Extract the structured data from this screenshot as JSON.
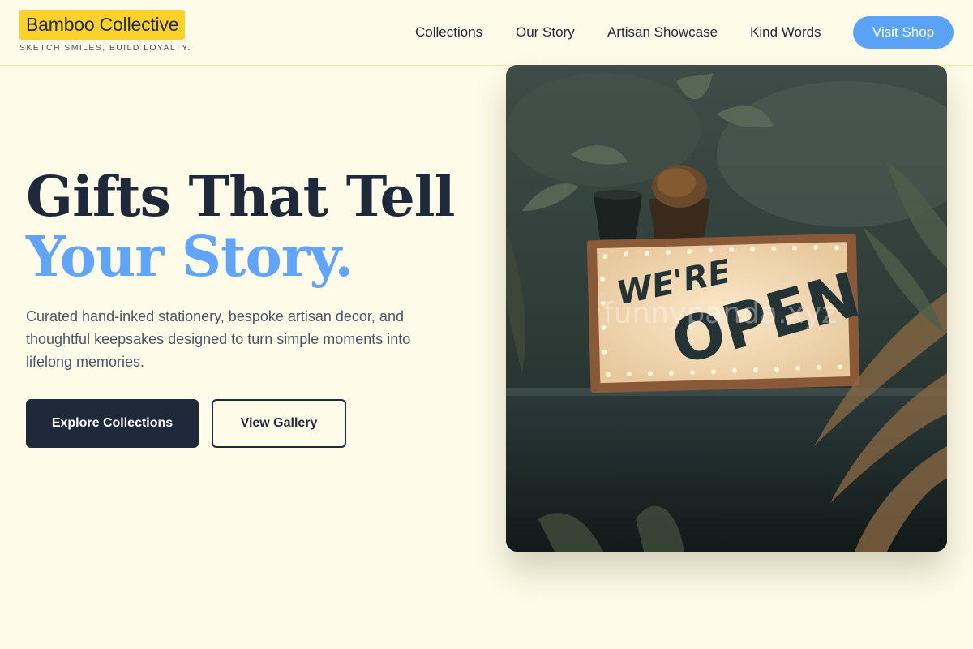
{
  "brand": {
    "name": "Bamboo Collective",
    "tagline": "SKETCH SMILES, BUILD LOYALTY.",
    "highlight_color": "#fcd12a"
  },
  "nav": {
    "links": [
      "Collections",
      "Our Story",
      "Artisan Showcase",
      "Kind Words"
    ],
    "cta_label": "Visit Shop",
    "cta_color": "#5ba3f6"
  },
  "hero": {
    "headline_line1": "Gifts That Tell",
    "headline_line2": "Your Story.",
    "accent_color": "#60a5fa",
    "description": "Curated hand-inked stationery, bespoke artisan decor, and thoughtful keepsakes designed to turn simple moments into lifelong memories.",
    "primary_button": "Explore Collections",
    "secondary_button": "View Gallery"
  },
  "image": {
    "subject": "storefront window sign",
    "sign_line1": "WE'RE",
    "sign_line2": "OPEN",
    "watermark": "funnypanda.xyz"
  },
  "colors": {
    "background": "#fefbe8",
    "text_dark": "#1e293b",
    "text_muted": "#475569"
  }
}
